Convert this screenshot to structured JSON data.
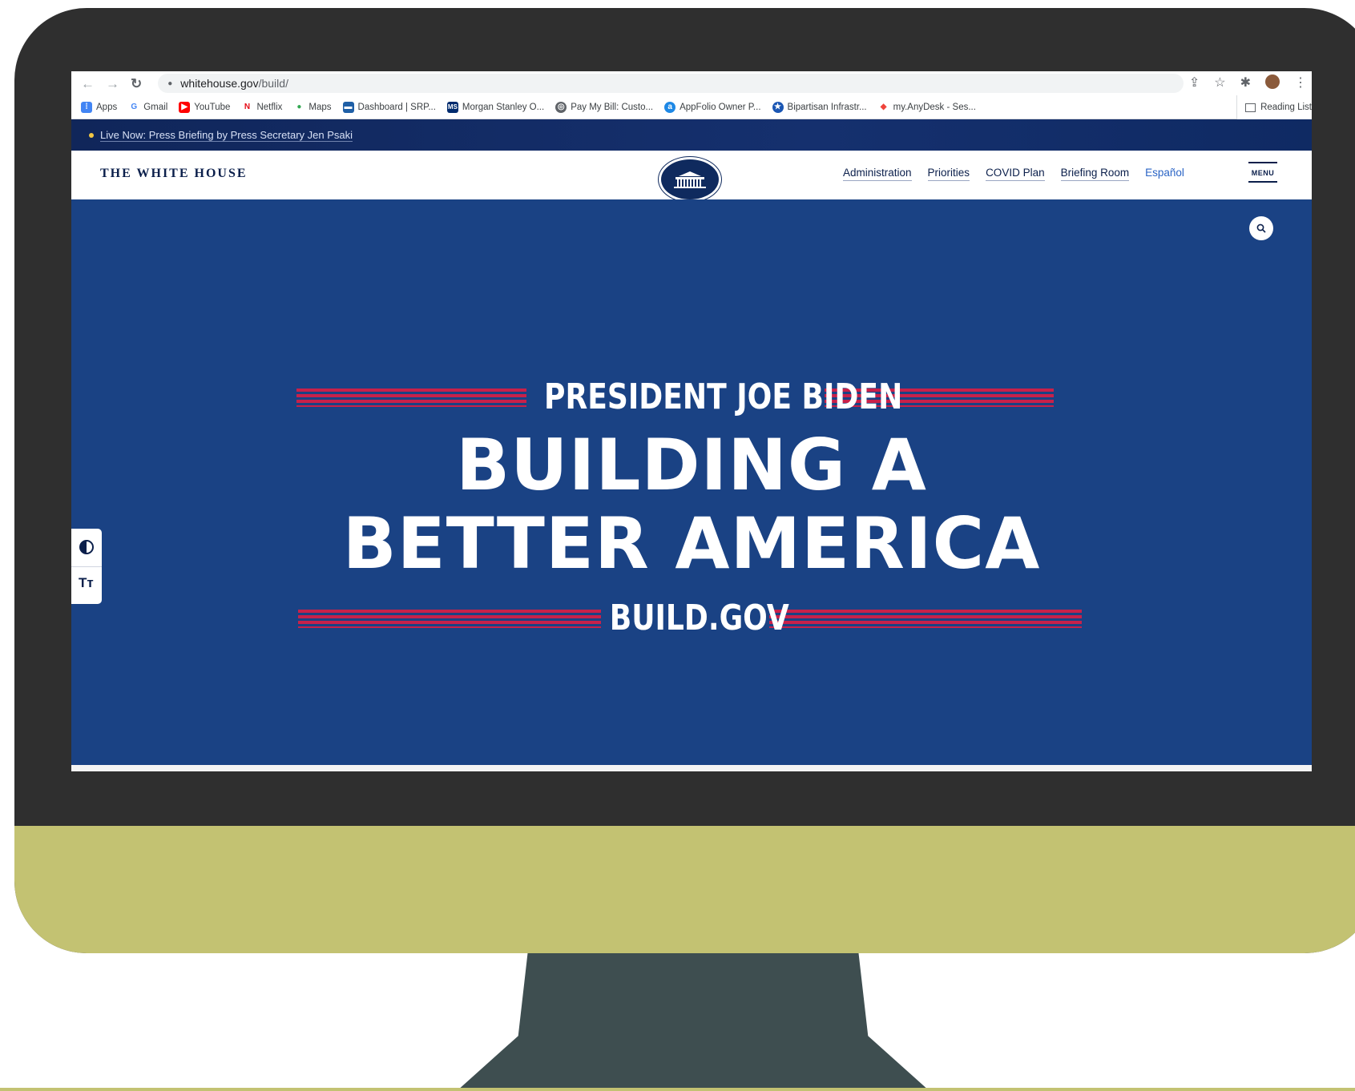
{
  "browser": {
    "url_host": "whitehouse.gov",
    "url_path": "/build/",
    "back_icon": "arrow-left-icon",
    "forward_icon": "arrow-right-icon",
    "reload_icon": "reload-icon"
  },
  "bookmarks": [
    {
      "label": "Apps",
      "icon": "apps-grid-icon",
      "color": "#4285f4"
    },
    {
      "label": "Gmail",
      "icon": "google-icon",
      "color": "#4285f4"
    },
    {
      "label": "YouTube",
      "icon": "youtube-icon",
      "color": "#ff0000"
    },
    {
      "label": "Netflix",
      "icon": "netflix-icon",
      "color": "#e50914"
    },
    {
      "label": "Maps",
      "icon": "maps-pin-icon",
      "color": "#34a853"
    },
    {
      "label": "Dashboard | SRP...",
      "icon": "srp-icon",
      "color": "#1f5fa6"
    },
    {
      "label": "Morgan Stanley O...",
      "icon": "ms-icon",
      "color": "#002b6e"
    },
    {
      "label": "Pay My Bill: Custo...",
      "icon": "globe-icon",
      "color": "#5f6368"
    },
    {
      "label": "AppFolio Owner P...",
      "icon": "appfolio-icon",
      "color": "#1e88e5"
    },
    {
      "label": "Bipartisan Infrastr...",
      "icon": "dot-gov-icon",
      "color": "#1a56b3"
    },
    {
      "label": "my.AnyDesk - Ses...",
      "icon": "anydesk-icon",
      "color": "#ef443b"
    }
  ],
  "reading_list": "Reading List",
  "live_banner": "Live Now: Press Briefing by Press Secretary Jen Psaki",
  "site": {
    "title": "THE WHITE HOUSE",
    "nav": [
      "Administration",
      "Priorities",
      "COVID Plan",
      "Briefing Room",
      "Español"
    ],
    "menu_label": "MENU"
  },
  "hero": {
    "kicker": "PRESIDENT JOE BIDEN",
    "headline_line1": "BUILDING A",
    "headline_line2": "BETTER AMERICA",
    "footer": "BUILD.GOV"
  },
  "colors": {
    "hero_blue": "#1a4284",
    "stripe_red": "#c8214a",
    "navy": "#0b1f4b",
    "monitor_chin": "#c3c272"
  }
}
